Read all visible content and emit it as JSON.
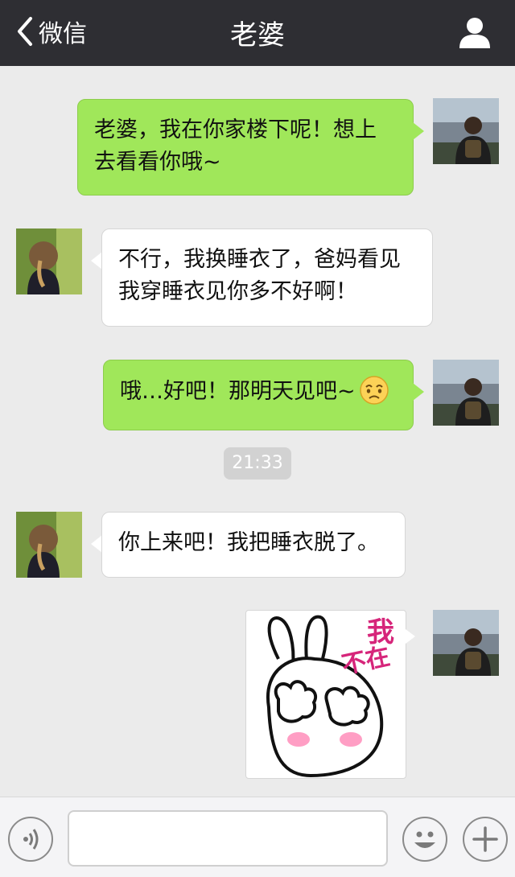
{
  "header": {
    "back_label": "微信",
    "title": "老婆"
  },
  "messages": [
    {
      "side": "right",
      "text_lines": [
        "老婆，我在你家楼下呢！想上",
        "去看看你哦~"
      ]
    },
    {
      "side": "left",
      "text_lines": [
        "不行，我换睡衣了，爸妈看见",
        "我穿睡衣见你多不好啊！"
      ]
    },
    {
      "side": "right",
      "text": "哦…好吧！那明天见吧~"
    },
    {
      "side": "left",
      "text": "你上来吧！我把睡衣脱了。"
    }
  ],
  "timestamp": "21:33",
  "sticker": {
    "text_top": "我",
    "text_bottom": "不在"
  },
  "icons": {
    "back": "chevron-left-icon",
    "profile": "person-icon",
    "voice": "voice-icon",
    "emoji": "smiley-icon",
    "plus": "plus-icon"
  },
  "colors": {
    "header_bg": "#2e2e33",
    "chat_bg": "#ebebeb",
    "my_bubble": "#a0e75a",
    "their_bubble": "#ffffff"
  }
}
